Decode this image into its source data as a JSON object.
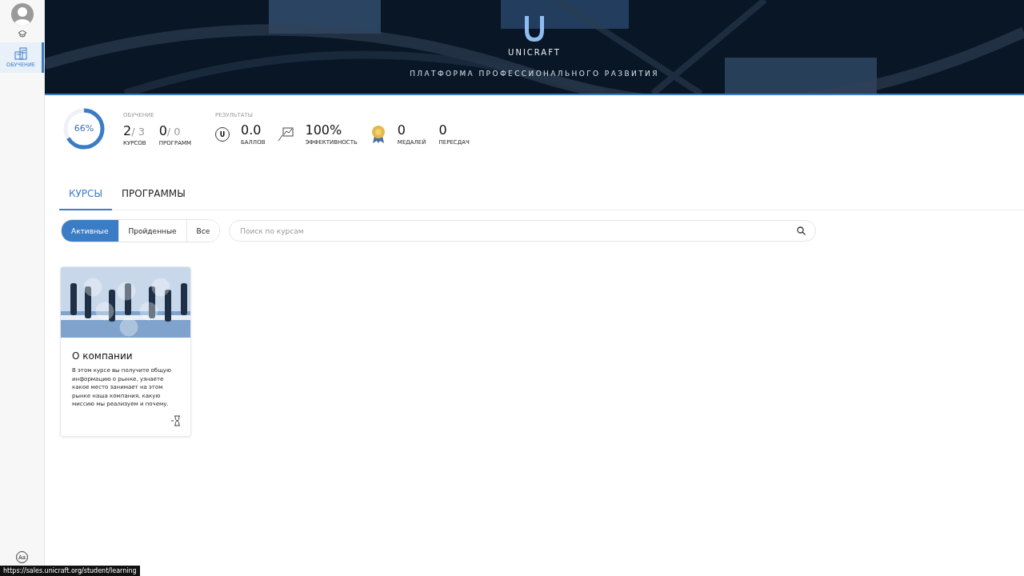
{
  "sidebar": {
    "items": [
      {
        "label": "ОБУЧЕНИЕ",
        "selected": true
      }
    ],
    "font_tool": "Aa"
  },
  "banner": {
    "logo": "UNICRAFT",
    "tagline": "ПЛАТФОРМА ПРОФЕССИОНАЛЬНОГО РАЗВИТИЯ"
  },
  "progress": {
    "level": 0.66,
    "reading": "66%"
  },
  "learning": {
    "title": "ОБУЧЕНИЕ",
    "stats": [
      {
        "value": "2",
        "total": "/ 3",
        "label": "КУРСОВ"
      },
      {
        "value": "0",
        "total": "/ 0",
        "label": "ПРОГРАММ"
      }
    ]
  },
  "results": {
    "title": "РЕЗУЛЬТАТЫ",
    "stats": [
      {
        "kind": "points",
        "icon_letter": "U",
        "value": "0.0",
        "label": "БАЛЛОВ"
      },
      {
        "kind": "efficiency",
        "value": "100%",
        "label": "ЭФФЕКТИВНОСТЬ"
      },
      {
        "kind": "medals",
        "value": "0",
        "label": "МЕДАЛЕЙ"
      },
      {
        "kind": "plain",
        "value": "0",
        "label": "ПЕРЕСДАЧ"
      }
    ]
  },
  "tabs": [
    {
      "label": "КУРСЫ",
      "selected": true
    },
    {
      "label": "ПРОГРАММЫ",
      "selected": false
    }
  ],
  "filters": [
    {
      "label": "Активные",
      "selected": true
    },
    {
      "label": "Пройденные",
      "selected": false
    },
    {
      "label": "Все",
      "selected": false
    }
  ],
  "search": {
    "placeholder": "Поиск по курсам"
  },
  "courses": [
    {
      "kind": "picture",
      "title": "О компании",
      "description": "В этом курсе вы получите общую информацию о рынке, узнаете какое место занимает на этом рынке наша компания, какую миссию мы реализуем и почему."
    }
  ],
  "status_url": "https://sales.unicraft.org/student/learning"
}
